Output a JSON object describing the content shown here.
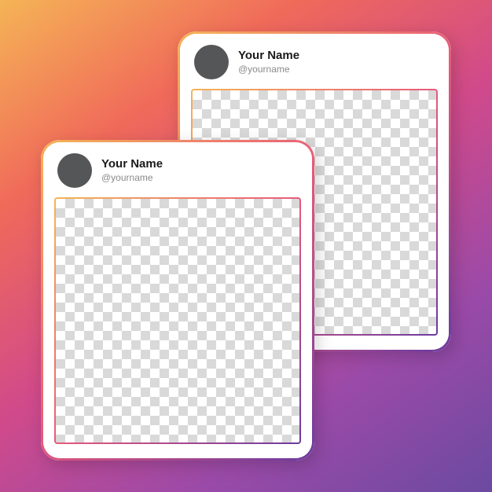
{
  "cards": {
    "back": {
      "display_name": "Your Name",
      "handle": "@yourname"
    },
    "front": {
      "display_name": "Your Name",
      "handle": "@yourname"
    }
  }
}
